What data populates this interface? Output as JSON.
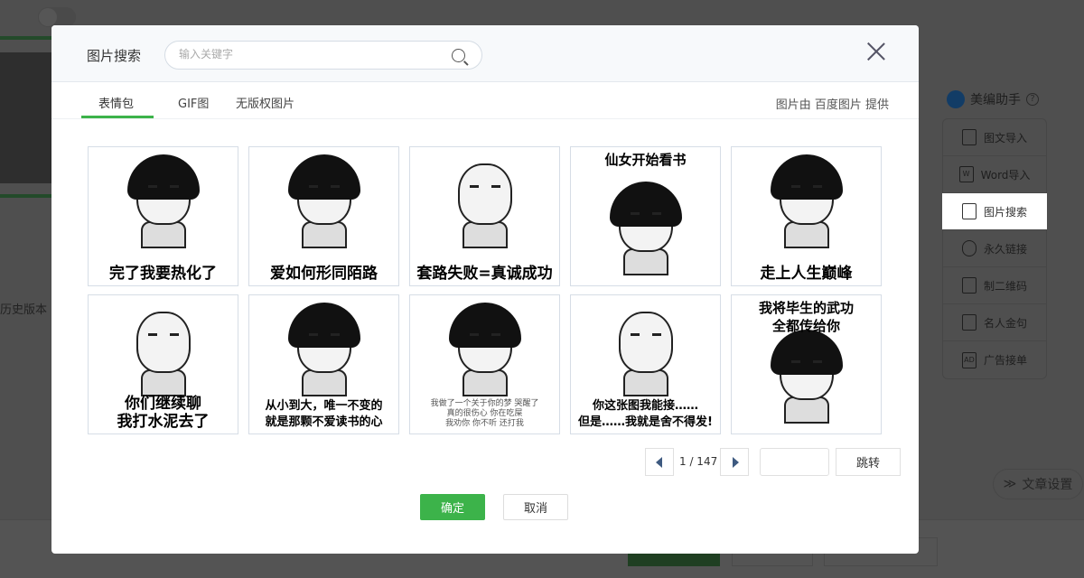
{
  "background": {
    "history_label": "历史版本",
    "helper_title": "美编助手",
    "helper_help": "?",
    "tools": [
      {
        "label": "图文导入",
        "icon": "image-import-icon"
      },
      {
        "label": "Word导入",
        "icon": "word-icon",
        "glyph": "W"
      },
      {
        "label": "图片搜索",
        "icon": "image-search-icon"
      },
      {
        "label": "永久链接",
        "icon": "link-icon"
      },
      {
        "label": "制二维码",
        "icon": "qrcode-icon"
      },
      {
        "label": "名人金句",
        "icon": "pen-icon"
      },
      {
        "label": "广告接单",
        "icon": "ad-icon",
        "glyph": "AD"
      }
    ],
    "article_settings": "文章设置"
  },
  "modal": {
    "title": "图片搜索",
    "search_placeholder": "输入关键字",
    "search_value": "",
    "tabs": [
      {
        "label": "表情包"
      },
      {
        "label": "GIF图"
      },
      {
        "label": "无版权图片"
      }
    ],
    "active_tab": "表情包",
    "provider": "图片由 百度图片 提供",
    "images": [
      {
        "caption": "完了我要热化了",
        "style": "bottom"
      },
      {
        "caption": "爱如何形同陌路",
        "style": "bottom"
      },
      {
        "caption": "套路失败=真诚成功",
        "style": "bottom"
      },
      {
        "caption": "仙女开始看书",
        "style": "top"
      },
      {
        "caption": "走上人生巅峰",
        "style": "bottom"
      },
      {
        "caption": "你们继续聊\n我打水泥去了",
        "style": "bottom"
      },
      {
        "caption": "从小到大，唯一不变的\n就是那颗不爱读书的心",
        "style": "mid"
      },
      {
        "caption": "我做了一个关于你的梦 哭醒了\n真的很伤心 你在吃屎\n我劝你 你不听 还打我",
        "style": "small"
      },
      {
        "caption": "你这张图我能接……\n但是……我就是舍不得发!",
        "style": "mid"
      },
      {
        "caption": "我将毕生的武功\n全都传给你",
        "style": "top"
      }
    ],
    "pagination": {
      "current": 1,
      "total": 147,
      "text": "1 / 147",
      "jump_value": "",
      "jump_label": "跳转"
    },
    "confirm_label": "确定",
    "cancel_label": "取消",
    "accent": "#3cb34a"
  }
}
